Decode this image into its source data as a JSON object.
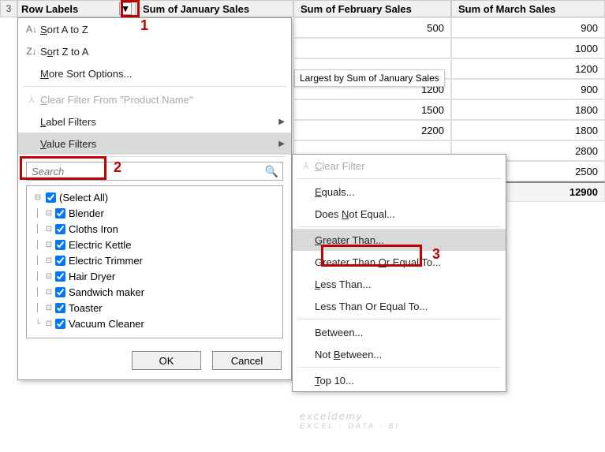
{
  "header": {
    "row_num": "3",
    "colA": "Row Labels",
    "colB": "Sum of January Sales",
    "colC": "Sum of February Sales",
    "colD": "Sum of March Sales"
  },
  "data_rows": [
    {
      "feb": "500",
      "mar": "900"
    },
    {
      "feb": "",
      "mar": "1000"
    },
    {
      "feb": "",
      "mar": "1200"
    },
    {
      "feb": "1200",
      "mar": "900"
    },
    {
      "feb": "1500",
      "mar": "1800"
    },
    {
      "feb": "2200",
      "mar": "1800"
    },
    {
      "feb": "",
      "mar": "2800"
    },
    {
      "feb": "",
      "mar": "2500"
    }
  ],
  "total_row": {
    "feb": "",
    "mar": "12900"
  },
  "tooltip_text": "Largest by Sum of January Sales",
  "menu1": {
    "sort_az": "Sort A to Z",
    "sort_za": "Sort Z to A",
    "more_sort": "More Sort Options...",
    "clear_filter": "Clear Filter From \"Product Name\"",
    "label_filters": "Label Filters",
    "value_filters": "Value Filters",
    "search_placeholder": "Search",
    "items": [
      "(Select All)",
      "Blender",
      "Cloths Iron",
      "Electric Kettle",
      "Electric Trimmer",
      "Hair Dryer",
      "Sandwich maker",
      "Toaster",
      "Vacuum Cleaner"
    ],
    "ok": "OK",
    "cancel": "Cancel"
  },
  "menu2": {
    "clear": "Clear Filter",
    "equals": "Equals...",
    "dne": "Does Not Equal...",
    "gt": "Greater Than...",
    "gte": "Greater Than Or Equal To...",
    "lt": "Less Than...",
    "lte": "Less Than Or Equal To...",
    "between": "Between...",
    "not_between": "Not Between...",
    "top10": "Top 10..."
  },
  "callouts": {
    "n1": "1",
    "n2": "2",
    "n3": "3"
  },
  "watermark": {
    "line1": "exceldemy",
    "line2": "EXCEL · DATA · BI"
  }
}
